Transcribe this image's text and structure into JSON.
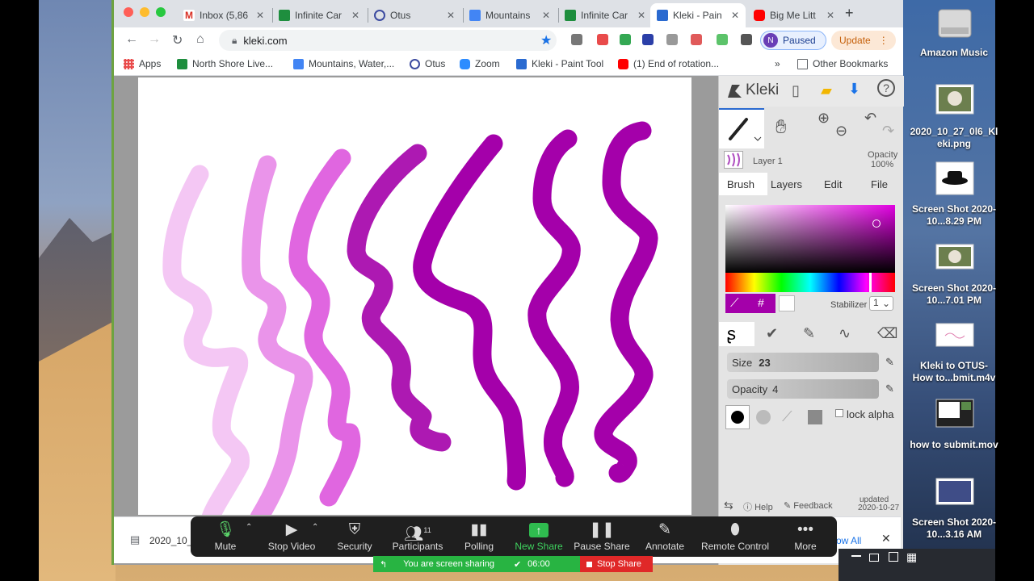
{
  "browser": {
    "tabs": [
      {
        "label": "Inbox (5,86",
        "icon": "gmail-icon",
        "color": "#d93025"
      },
      {
        "label": "Infinite Car",
        "icon": "classroom-icon",
        "color": "#1e8e3e"
      },
      {
        "label": "Otus",
        "icon": "otus-icon",
        "color": "#3c4ba0"
      },
      {
        "label": "Mountains",
        "icon": "docs-icon",
        "color": "#4285f4"
      },
      {
        "label": "Infinite Car",
        "icon": "classroom-icon",
        "color": "#1e8e3e"
      },
      {
        "label": "Kleki - Pain",
        "icon": "kleki-icon",
        "color": "#2a6ad0"
      },
      {
        "label": "Big Me Litt",
        "icon": "youtube-icon",
        "color": "#ff0000"
      }
    ],
    "url": "kleki.com",
    "profile_initial": "N",
    "paused_label": "Paused",
    "update_label": "Update",
    "bookmarks": [
      {
        "label": "Apps"
      },
      {
        "label": "North Shore Live..."
      },
      {
        "label": "Mountains, Water,..."
      },
      {
        "label": "Otus"
      },
      {
        "label": "Zoom"
      },
      {
        "label": "Kleki - Paint Tool"
      },
      {
        "label": "(1) End of rotation..."
      }
    ],
    "other_bookmarks": "Other Bookmarks",
    "overflow": "»"
  },
  "kleki": {
    "logo_text": "Kleki",
    "layer_name": "Layer 1",
    "opacity_label": "Opacity",
    "opacity_value": "100%",
    "tabs": [
      "Brush",
      "Layers",
      "Edit",
      "File"
    ],
    "hash": "#",
    "stabilizer_label": "Stabilizer",
    "stabilizer_value": "1",
    "size_label": "Size",
    "size_value": "23",
    "brush_opacity_label": "Opacity",
    "brush_opacity_value": "4",
    "lock_alpha": "lock alpha",
    "help": "Help",
    "feedback": "Feedback",
    "updated_label": "updated",
    "updated_date": "2020-10-27",
    "current_color": "#cc00cc"
  },
  "download": {
    "file": "2020_10_",
    "show_all": "ow All"
  },
  "zoom": {
    "items": [
      {
        "label": "Mute",
        "icon": "mic-icon"
      },
      {
        "label": "Stop Video",
        "icon": "video-icon"
      },
      {
        "label": "Security",
        "icon": "shield-icon"
      },
      {
        "label": "Participants",
        "icon": "participants-icon",
        "count": "11"
      },
      {
        "label": "Polling",
        "icon": "polling-icon"
      },
      {
        "label": "New Share",
        "icon": "share-icon"
      },
      {
        "label": "Pause Share",
        "icon": "pause-icon"
      },
      {
        "label": "Annotate",
        "icon": "pen-icon"
      },
      {
        "label": "Remote Control",
        "icon": "mouse-icon"
      },
      {
        "label": "More",
        "icon": "more-icon"
      }
    ],
    "sharing_status": "You are screen sharing",
    "timer": "06:00",
    "stop_share": "Stop Share"
  },
  "desktop": {
    "icons": [
      {
        "label": "Amazon Music"
      },
      {
        "label": "2020_10_27_0l6_Kl eki.png"
      },
      {
        "label": "Screen Shot 2020-10...8.29 PM"
      },
      {
        "label": "Screen Shot 2020-10...7.01 PM"
      },
      {
        "label": "Kleki to OTUS- How to...bmit.m4v"
      },
      {
        "label": "how to submit.mov"
      },
      {
        "label": "Screen Shot 2020-10...3.16 AM"
      }
    ]
  }
}
